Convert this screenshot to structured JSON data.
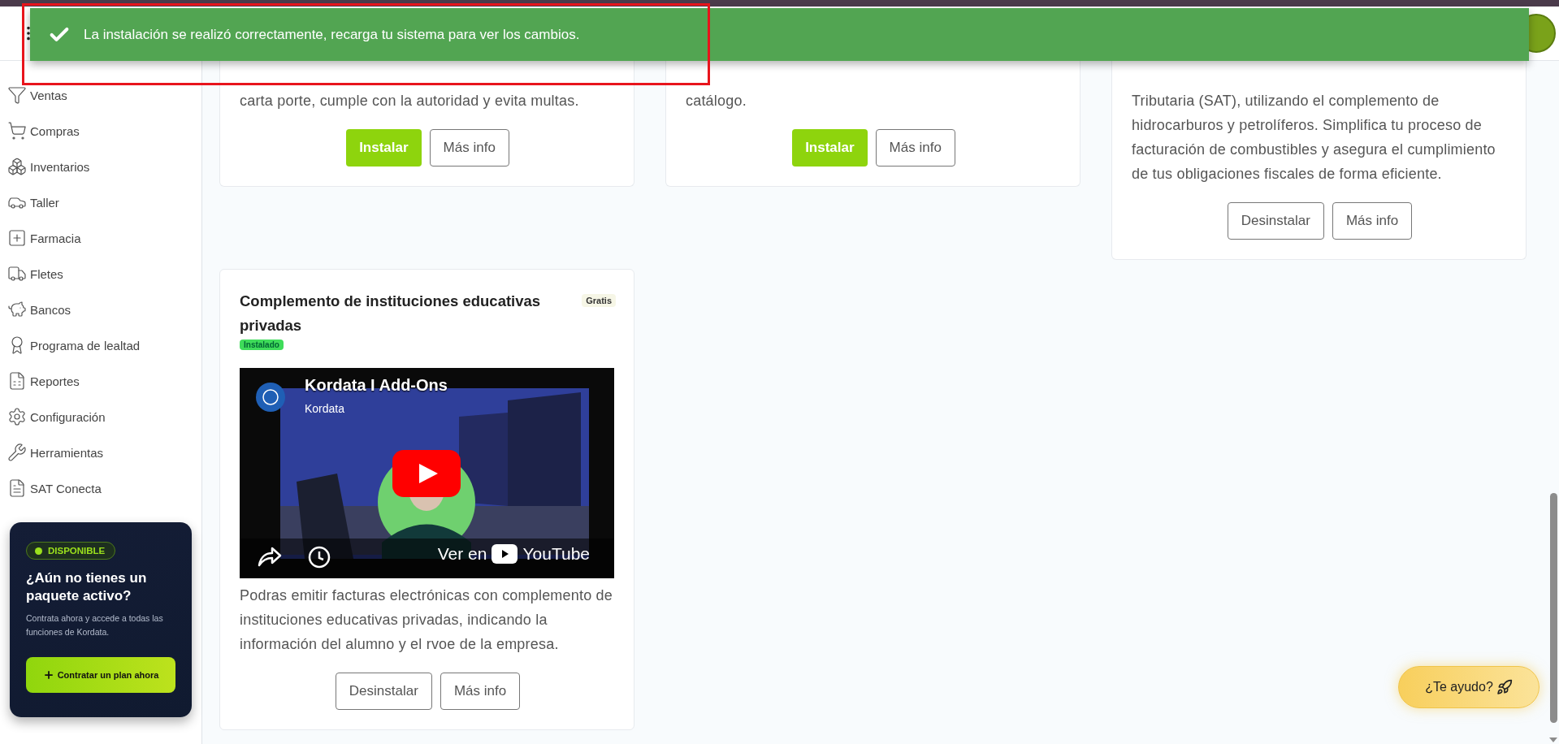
{
  "toast": {
    "kind": "success",
    "message": "La instalación se realizó correctamente, recarga tu sistema para ver los cambios."
  },
  "sidebar": {
    "items": [
      {
        "label": "Ventas"
      },
      {
        "label": "Compras"
      },
      {
        "label": "Inventarios"
      },
      {
        "label": "Taller"
      },
      {
        "label": "Farmacia"
      },
      {
        "label": "Fletes"
      },
      {
        "label": "Bancos"
      },
      {
        "label": "Programa de lealtad"
      },
      {
        "label": "Reportes"
      },
      {
        "label": "Configuración"
      },
      {
        "label": "Herramientas"
      },
      {
        "label": "SAT Conecta"
      }
    ]
  },
  "promo": {
    "badge": "DISPONIBLE",
    "title": "¿Aún no tienes un paquete activo?",
    "text": "Contrata ahora y accede a todas las funciones de Kordata.",
    "button": "Contratar un plan ahora"
  },
  "cards": [
    {
      "description": "carta porte, cumple con la autoridad y evita multas.",
      "buttons": [
        {
          "label": "Instalar",
          "kind": "primary"
        },
        {
          "label": "Más info",
          "kind": "outline"
        }
      ]
    },
    {
      "description": "catálogo.",
      "buttons": [
        {
          "label": "Instalar",
          "kind": "primary"
        },
        {
          "label": "Más info",
          "kind": "outline"
        }
      ]
    },
    {
      "description": "Tributaria (SAT), utilizando el complemento de hidrocarburos y petrolíferos. Simplifica tu proceso de facturación de combustibles y asegura el cumplimiento de tus obligaciones fiscales de forma eficiente.",
      "buttons": [
        {
          "label": "Desinstalar",
          "kind": "outline"
        },
        {
          "label": "Más info",
          "kind": "outline"
        }
      ]
    },
    {
      "title": "Complemento de instituciones educativas privadas",
      "price": "Gratis",
      "status": "Instalado",
      "video": {
        "title": "Kordata I Add-Ons",
        "channel": "Kordata",
        "watch_label": "Ver en",
        "platform": "YouTube"
      },
      "description": "Podras emitir facturas electrónicas con complemento de instituciones educativas privadas, indicando la información del alumno y el rvoe de la empresa.",
      "buttons": [
        {
          "label": "Desinstalar",
          "kind": "outline"
        },
        {
          "label": "Más info",
          "kind": "outline"
        }
      ]
    }
  ],
  "help_button": {
    "label": "¿Te ayudo?"
  }
}
